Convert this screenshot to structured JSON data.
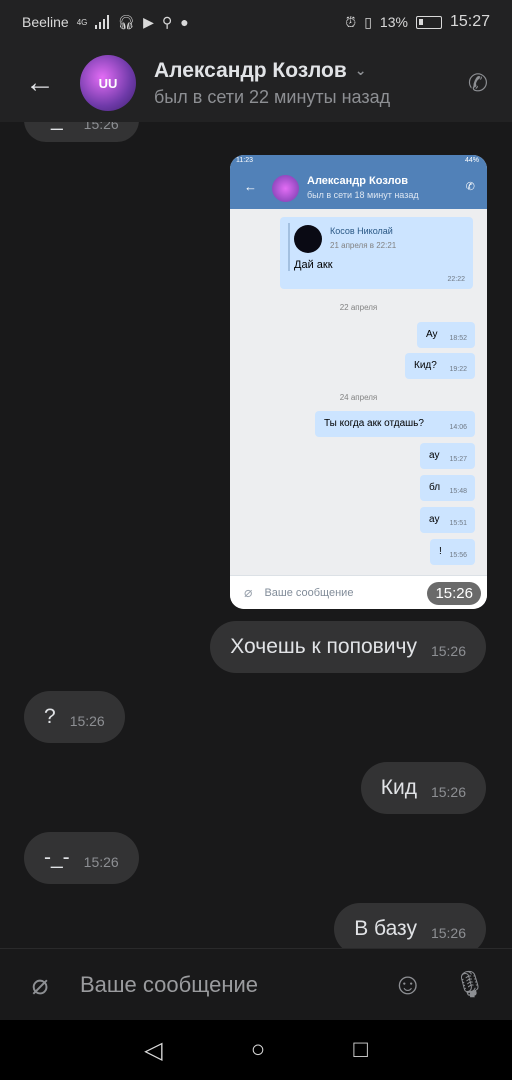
{
  "status": {
    "carrier": "Beeline",
    "net": "4G",
    "battery": "13%",
    "time": "15:27"
  },
  "header": {
    "name": "Александр Козлов",
    "status": "был в сети 22 минуты назад",
    "avatar_text": "UU"
  },
  "messages": [
    {
      "text": "-_-",
      "time": "15:26",
      "dir": "in"
    },
    {
      "text": "Хочешь к поповичу",
      "time": "15:26",
      "dir": "out"
    },
    {
      "text": "?",
      "time": "15:26",
      "dir": "in"
    },
    {
      "text": "Кид",
      "time": "15:26",
      "dir": "out"
    },
    {
      "text": "-_-",
      "time": "15:26",
      "dir": "in"
    },
    {
      "text": "В базу",
      "time": "15:26",
      "dir": "out"
    }
  ],
  "screenshot": {
    "status_time": "11:23",
    "battery": "44%",
    "name": "Александр Козлов",
    "status": "был в сети 18 минут назад",
    "forward_author": "Косов Николай",
    "forward_date": "21 апреля в 22:21",
    "forward_text": "Дай акк",
    "forward_time": "22:22",
    "date1": "22 апреля",
    "m1": {
      "text": "Ау",
      "time": "18:52"
    },
    "m2": {
      "text": "Кид?",
      "time": "19:22"
    },
    "date2": "24 апреля",
    "m3": {
      "text": "Ты когда акк отдашь?",
      "time": "14:06"
    },
    "m4": {
      "text": "ау",
      "time": "15:27"
    },
    "m5": {
      "text": "бл",
      "time": "15:48"
    },
    "m6": {
      "text": "ау",
      "time": "15:51"
    },
    "m7": {
      "text": "!",
      "time": "15:56"
    },
    "input_placeholder": "Ваше сообщение",
    "time_badge": "15:26"
  },
  "composer": {
    "placeholder": "Ваше сообщение"
  }
}
